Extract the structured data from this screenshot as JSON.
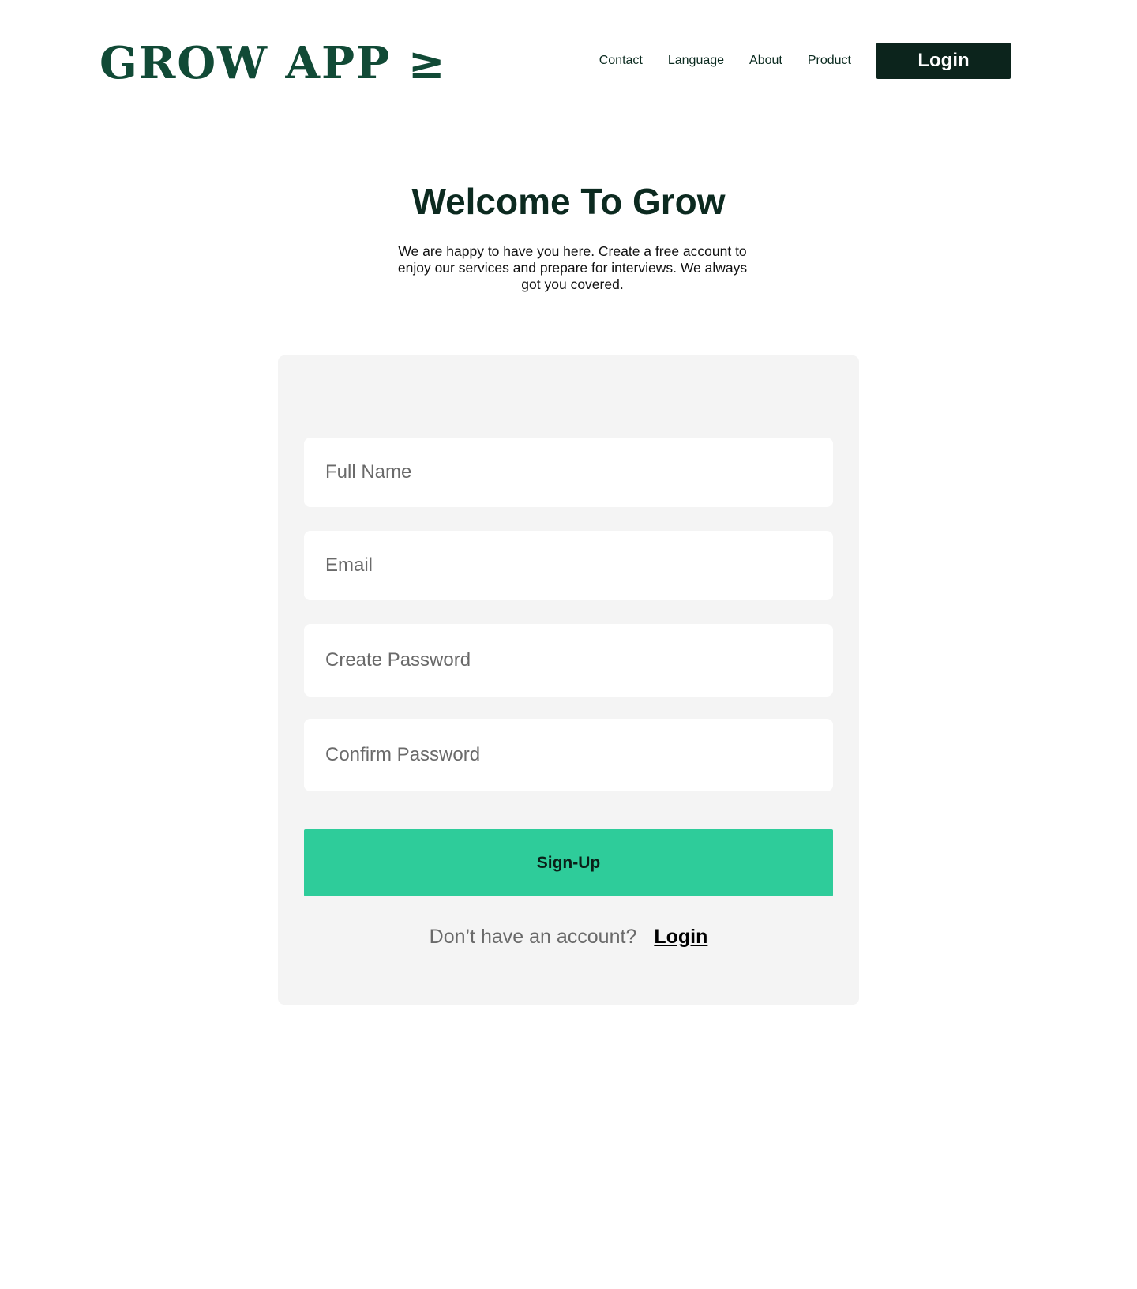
{
  "header": {
    "logo_text": "GROW APP ≥",
    "nav": {
      "contact": "Contact",
      "language": "Language",
      "about": "About",
      "product": "Product"
    },
    "login_label": "Login"
  },
  "hero": {
    "title": "Welcome To Grow",
    "subtitle": "We are happy to have you here. Create a free account to enjoy our services and prepare for interviews. We always got you covered."
  },
  "form": {
    "full_name_placeholder": "Full Name",
    "email_placeholder": "Email",
    "create_password_placeholder": "Create Password",
    "confirm_password_placeholder": "Confirm Password",
    "signup_label": "Sign-Up",
    "account_question": "Don’t have an account?",
    "login_link": "Login"
  },
  "colors": {
    "brand_dark": "#0c241c",
    "logo_green": "#114a36",
    "accent_green": "#2ecc9a",
    "card_bg": "#f4f4f4"
  }
}
